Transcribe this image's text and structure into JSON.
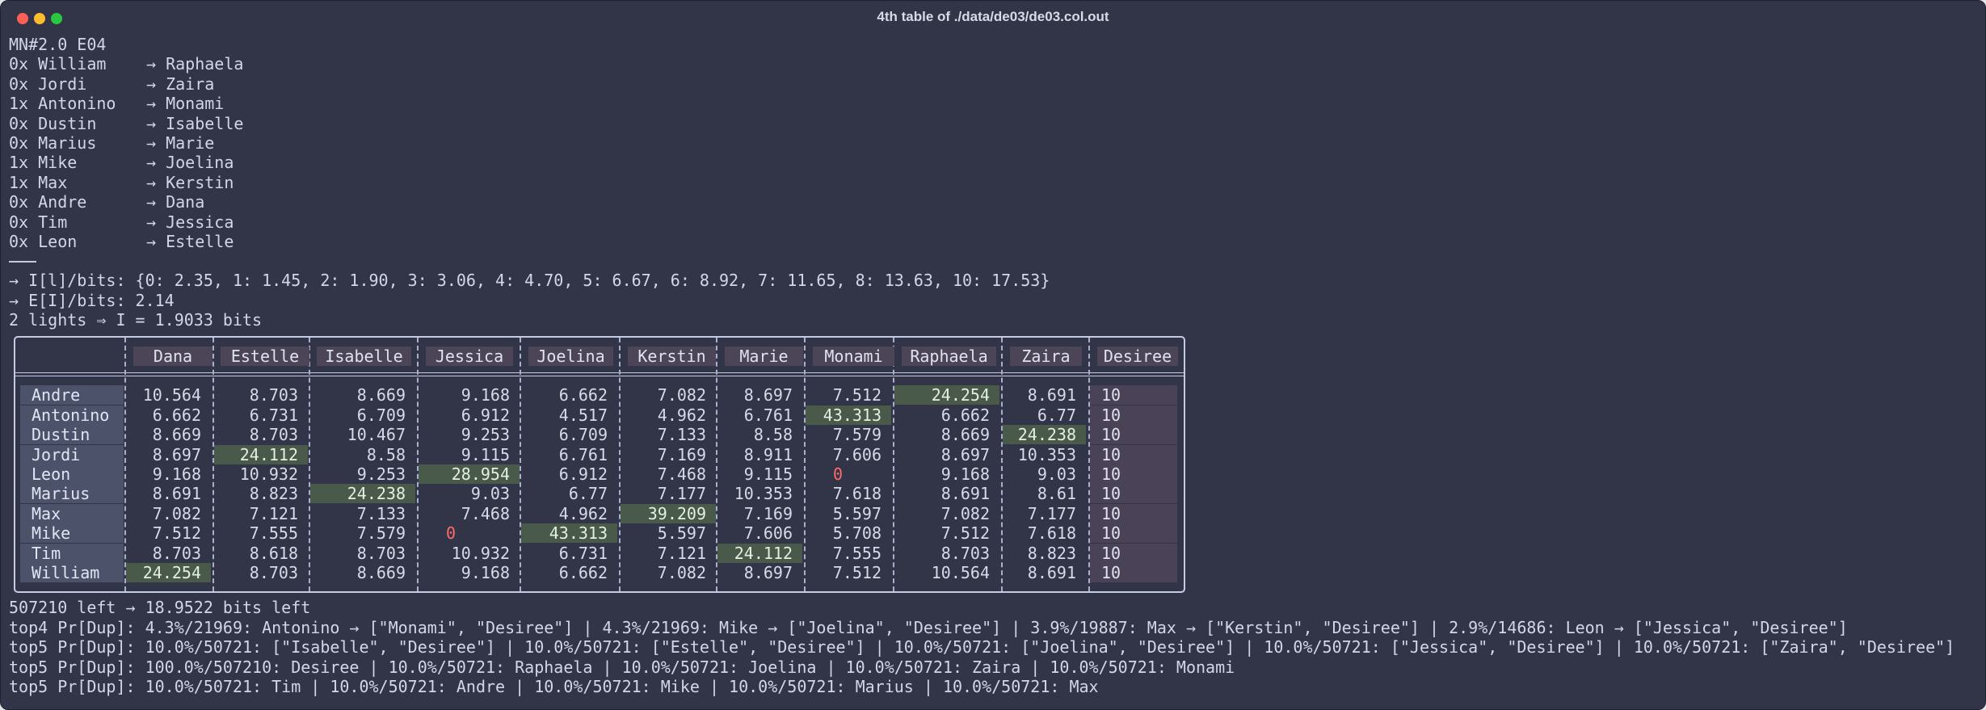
{
  "window": {
    "title": "4th table of ./data/de03/de03.col.out"
  },
  "header_line": "MN#2.0 E04",
  "arrow": "→",
  "mappings": [
    {
      "count": "0x",
      "from": "William",
      "to": "Raphaela"
    },
    {
      "count": "0x",
      "from": "Jordi",
      "to": "Zaira"
    },
    {
      "count": "1x",
      "from": "Antonino",
      "to": "Monami"
    },
    {
      "count": "0x",
      "from": "Dustin",
      "to": "Isabelle"
    },
    {
      "count": "0x",
      "from": "Marius",
      "to": "Marie"
    },
    {
      "count": "1x",
      "from": "Mike",
      "to": "Joelina"
    },
    {
      "count": "1x",
      "from": "Max",
      "to": "Kerstin"
    },
    {
      "count": "0x",
      "from": "Andre",
      "to": "Dana"
    },
    {
      "count": "0x",
      "from": "Tim",
      "to": "Jessica"
    },
    {
      "count": "0x",
      "from": "Leon",
      "to": "Estelle"
    }
  ],
  "info_lines": [
    "→ I[l]/bits: {0: 2.35, 1: 1.45, 2: 1.90, 3: 3.06, 4: 4.70, 5: 6.67, 6: 8.92, 7: 11.65, 8: 13.63, 10: 17.53}",
    "→ E[I]/bits: 2.14",
    "2 lights ⇒ I = 1.9033 bits"
  ],
  "table": {
    "columns": [
      "Dana",
      "Estelle",
      "Isabelle",
      "Jessica",
      "Joelina",
      "Kerstin",
      "Marie",
      "Monami",
      "Raphaela",
      "Zaira",
      "Desiree"
    ],
    "rows": [
      {
        "name": "Andre",
        "values": [
          "10.564",
          "8.703",
          "8.669",
          "9.168",
          "6.662",
          "7.082",
          "8.697",
          "7.512",
          "24.254",
          "8.691",
          "10"
        ],
        "hi": [
          8
        ]
      },
      {
        "name": "Antonino",
        "values": [
          "6.662",
          "6.731",
          "6.709",
          "6.912",
          "4.517",
          "4.962",
          "6.761",
          "43.313",
          "6.662",
          "6.77",
          "10"
        ],
        "hi": [
          7
        ]
      },
      {
        "name": "Dustin",
        "values": [
          "8.669",
          "8.703",
          "10.467",
          "9.253",
          "6.709",
          "7.133",
          "8.58",
          "7.579",
          "8.669",
          "24.238",
          "10"
        ],
        "hi": [
          9
        ]
      },
      {
        "name": "Jordi",
        "values": [
          "8.697",
          "24.112",
          "8.58",
          "9.115",
          "6.761",
          "7.169",
          "8.911",
          "7.606",
          "8.697",
          "10.353",
          "10"
        ],
        "hi": [
          1
        ]
      },
      {
        "name": "Leon",
        "values": [
          "9.168",
          "10.932",
          "9.253",
          "28.954",
          "6.912",
          "7.468",
          "9.115",
          "0",
          "9.168",
          "9.03",
          "10"
        ],
        "hi": [
          3
        ],
        "zero": [
          7
        ]
      },
      {
        "name": "Marius",
        "values": [
          "8.691",
          "8.823",
          "24.238",
          "9.03",
          "6.77",
          "7.177",
          "10.353",
          "7.618",
          "8.691",
          "8.61",
          "10"
        ],
        "hi": [
          2
        ]
      },
      {
        "name": "Max",
        "values": [
          "7.082",
          "7.121",
          "7.133",
          "7.468",
          "4.962",
          "39.209",
          "7.169",
          "5.597",
          "7.082",
          "7.177",
          "10"
        ],
        "hi": [
          5
        ]
      },
      {
        "name": "Mike",
        "values": [
          "7.512",
          "7.555",
          "7.579",
          "0",
          "43.313",
          "5.597",
          "7.606",
          "5.708",
          "7.512",
          "7.618",
          "10"
        ],
        "hi": [
          4
        ],
        "zero": [
          3
        ]
      },
      {
        "name": "Tim",
        "values": [
          "8.703",
          "8.618",
          "8.703",
          "10.932",
          "6.731",
          "7.121",
          "24.112",
          "7.555",
          "8.703",
          "8.823",
          "10"
        ],
        "hi": [
          6
        ]
      },
      {
        "name": "William",
        "values": [
          "24.254",
          "8.703",
          "8.669",
          "9.168",
          "6.662",
          "7.082",
          "8.697",
          "7.512",
          "10.564",
          "8.691",
          "10"
        ],
        "hi": [
          0
        ]
      }
    ]
  },
  "footer_lines": [
    "507210 left → 18.9522 bits left",
    "top4 Pr[Dup]: 4.3%/21969: Antonino → [\"Monami\", \"Desiree\"] | 4.3%/21969: Mike → [\"Joelina\", \"Desiree\"] | 3.9%/19887: Max → [\"Kerstin\", \"Desiree\"] | 2.9%/14686: Leon → [\"Jessica\", \"Desiree\"]",
    "top5 Pr[Dup]: 10.0%/50721: [\"Isabelle\", \"Desiree\"] | 10.0%/50721: [\"Estelle\", \"Desiree\"] | 10.0%/50721: [\"Joelina\", \"Desiree\"] | 10.0%/50721: [\"Jessica\", \"Desiree\"] | 10.0%/50721: [\"Zaira\", \"Desiree\"]",
    "top5 Pr[Dup]: 100.0%/507210: Desiree | 10.0%/50721: Raphaela | 10.0%/50721: Joelina | 10.0%/50721: Zaira | 10.0%/50721: Monami",
    "top5 Pr[Dup]: 10.0%/50721: Tim | 10.0%/50721: Andre | 10.0%/50721: Mike | 10.0%/50721: Marius | 10.0%/50721: Max"
  ]
}
